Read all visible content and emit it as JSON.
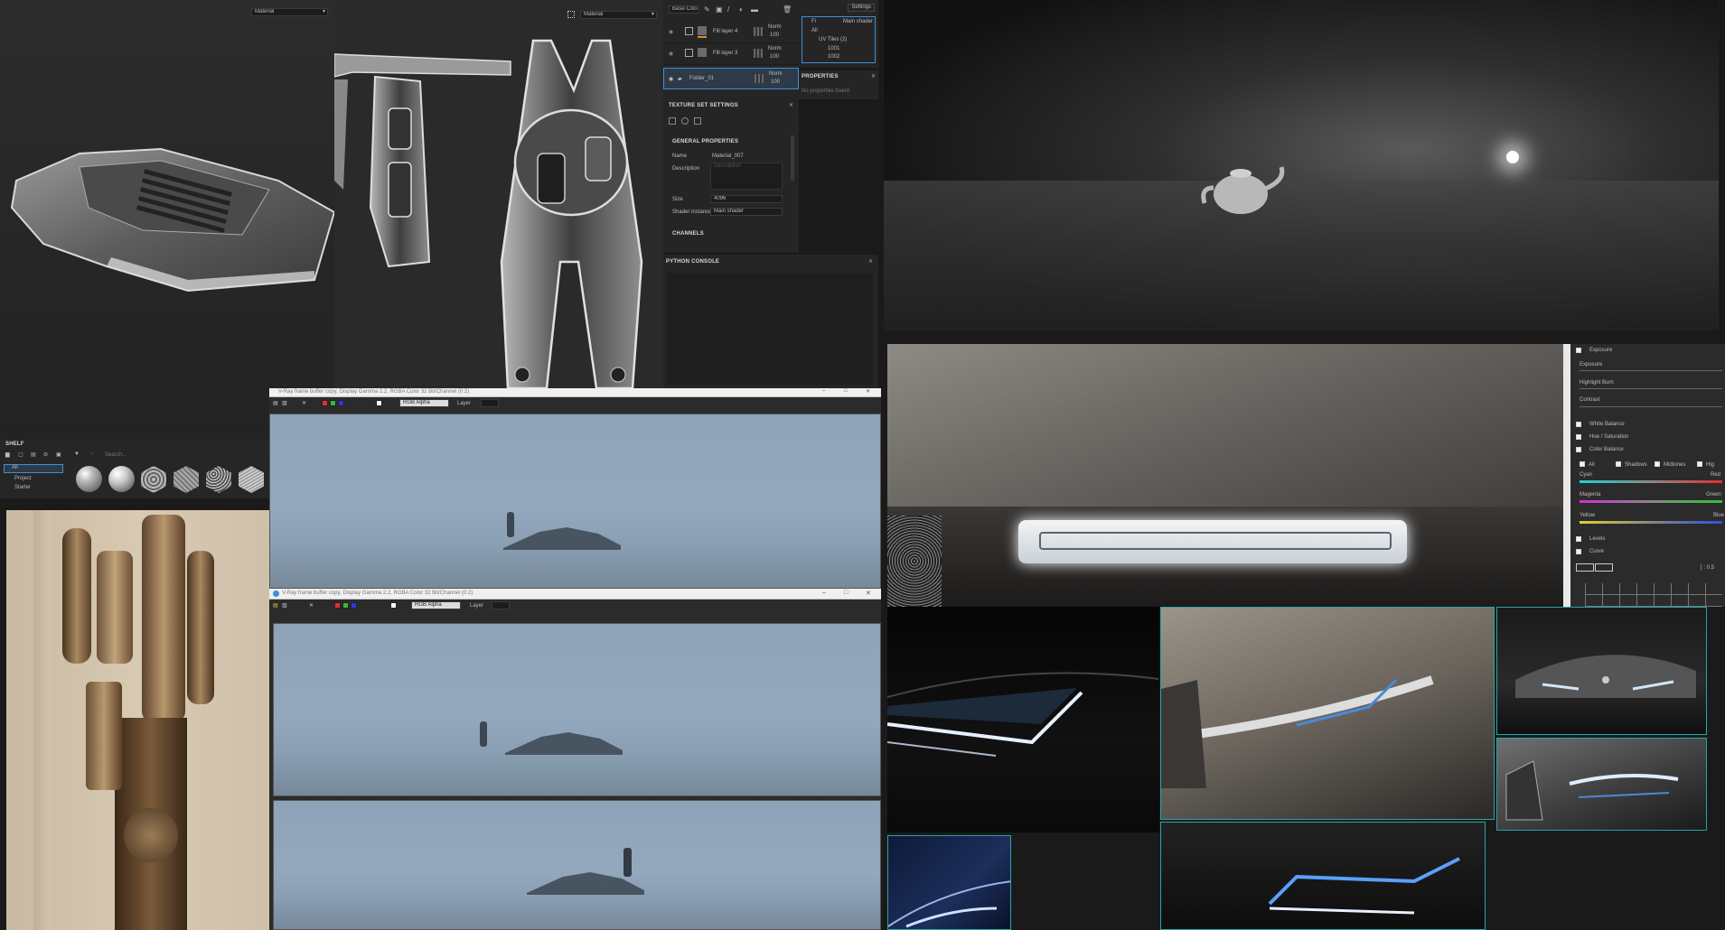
{
  "viewport_3d": {
    "material_dropdown": "Material"
  },
  "viewport_2d": {
    "material_dropdown": "Material"
  },
  "layers": {
    "blend_mode": "Base Colo",
    "settings_label": "Settings",
    "items": [
      {
        "name": "Fill layer 4",
        "blend": "Norm",
        "opacity": "100"
      },
      {
        "name": "Fill layer 3",
        "blend": "Norm",
        "opacity": "100"
      },
      {
        "name": "Folder_01",
        "blend": "Norm",
        "opacity": "100"
      }
    ]
  },
  "outliner": {
    "header_left": "Fi",
    "header_right": "Main shader",
    "item_all": "All",
    "item_uv": "UV Tiles (2)",
    "item_1001": "1001",
    "item_1002": "1002"
  },
  "properties": {
    "title": "PROPERTIES",
    "empty_text": "No properties found"
  },
  "texture_set": {
    "title": "TEXTURE SET SETTINGS",
    "general_properties": "GENERAL PROPERTIES",
    "name_label": "Name",
    "name_value": "Material_007",
    "description_label": "Description",
    "description_placeholder": "Description",
    "size_label": "Size",
    "size_value": "4096",
    "shader_label": "Shader instance",
    "shader_value": "Main shader",
    "channels": "CHANNELS"
  },
  "python_console": {
    "title": "PYTHON CONSOLE"
  },
  "shelf": {
    "title": "SHELF",
    "search_placeholder": "Search...",
    "categories": [
      "All",
      "Project",
      "Starter"
    ]
  },
  "vfb1": {
    "title": "V-Ray frame buffer copy, Display Gamma 2.2, RGBA Color 32 Bit/Channel (0:2)",
    "channel": "RGB Alpha",
    "layer_label": "Layer"
  },
  "vfb2": {
    "title": "V-Ray frame buffer copy, Display Gamma 2.2, RGBA Color 32 Bit/Channel (0:2)",
    "channel": "RGB Alpha",
    "layer_label": "Layer"
  },
  "color_panel": {
    "exposure_group": "Exposure",
    "exposure": "Exposure",
    "highlight_burn": "Highlight Burn",
    "contrast": "Contrast",
    "white_balance": "White Balance",
    "hue_saturation": "Hue / Saturation",
    "color_balance": "Color Balance",
    "ranges": [
      "All",
      "Shadows",
      "Midtones",
      "Hig"
    ],
    "cyan": "Cyan",
    "red": "Red",
    "magenta": "Magenta",
    "green": "Green",
    "yellow": "Yellow",
    "blue": "Blue",
    "levels": "Levels",
    "curve": "Curve",
    "curve_value": "[ : 0.5"
  },
  "colors": {
    "accent_blue": "#3d8fd8",
    "orange_mark": "#e08a2a",
    "cyan_border": "#2aa3a8",
    "panel_bg": "#252525"
  }
}
